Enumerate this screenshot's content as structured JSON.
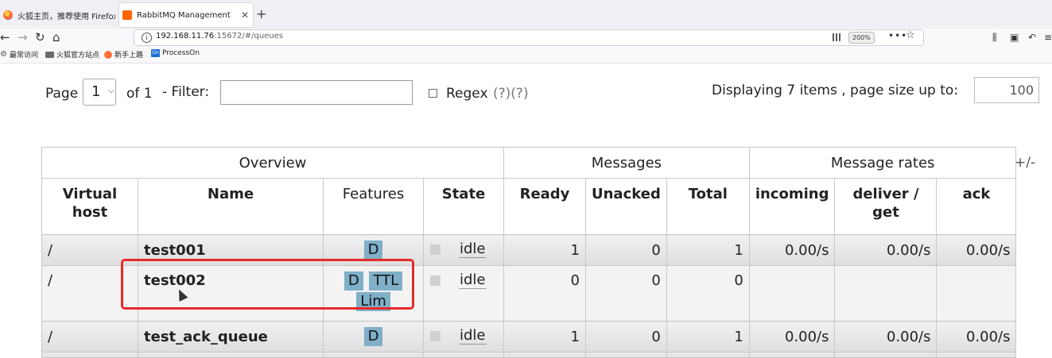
{
  "browser": {
    "tabs": [
      {
        "title": "火狐主页，推荐使用 Firefox 火",
        "active": false
      },
      {
        "title": "RabbitMQ Management",
        "active": true
      }
    ],
    "url_host": "192.168.11.76",
    "url_rest": ":15672/#/queues",
    "zoom": "200%",
    "bookmarks": [
      "最常访问",
      "火狐官方站点",
      "新手上路",
      "ProcessOn"
    ]
  },
  "pager": {
    "page_label": "Page",
    "page_value": "1",
    "of_label": "of 1",
    "filter_label": "- Filter:",
    "filter_value": "",
    "regex_label": "Regex",
    "regex_help": "(?)(?)",
    "displaying": "Displaying 7 items , page size up to:",
    "page_size": "100"
  },
  "table": {
    "groups": [
      "Overview",
      "Messages",
      "Message rates"
    ],
    "columns": {
      "vhost": "Virtual host",
      "name": "Name",
      "features": "Features",
      "state": "State",
      "ready": "Ready",
      "unacked": "Unacked",
      "total": "Total",
      "incoming": "incoming",
      "deliver": "deliver / get",
      "ack": "ack"
    },
    "toggle": "+/-",
    "rows": [
      {
        "vhost": "/",
        "name": "test001",
        "features": [
          "D"
        ],
        "state": "idle",
        "ready": "1",
        "unacked": "0",
        "total": "1",
        "incoming": "0.00/s",
        "deliver": "0.00/s",
        "ack": "0.00/s"
      },
      {
        "vhost": "/",
        "name": "test002",
        "features": [
          "D",
          "TTL",
          "Lim"
        ],
        "state": "idle",
        "ready": "0",
        "unacked": "0",
        "total": "0",
        "incoming": "",
        "deliver": "",
        "ack": ""
      },
      {
        "vhost": "/",
        "name": "test_ack_queue",
        "features": [
          "D"
        ],
        "state": "idle",
        "ready": "1",
        "unacked": "0",
        "total": "1",
        "incoming": "0.00/s",
        "deliver": "0.00/s",
        "ack": "0.00/s"
      }
    ]
  },
  "colors": {
    "badge": "#7fb0c8",
    "highlight": "#e52a2a"
  }
}
